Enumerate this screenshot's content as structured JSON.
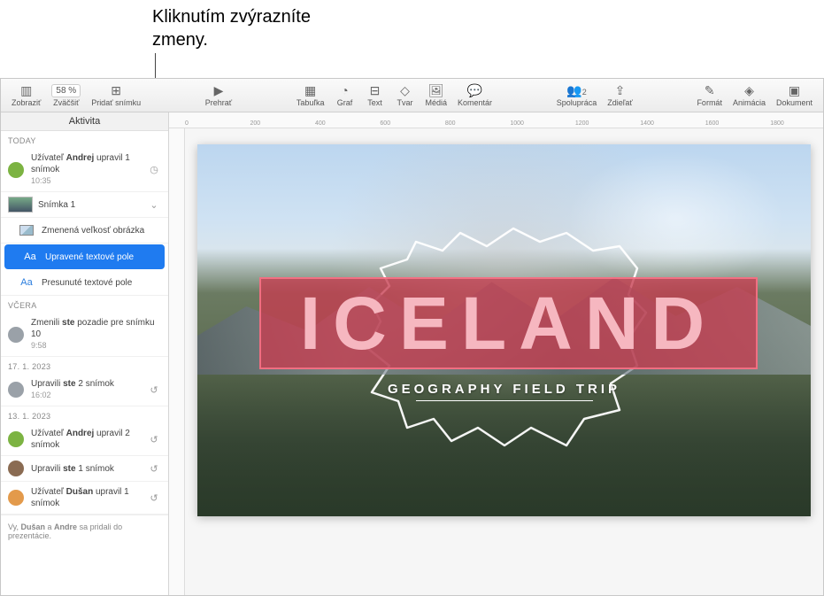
{
  "callout": {
    "line1": "Kliknutím zvýrazníte",
    "line2": "zmeny."
  },
  "toolbar": {
    "view": "Zobraziť",
    "zoom": "Zväčšiť",
    "zoom_value": "58 %",
    "add_slide": "Pridať snímku",
    "play": "Prehrať",
    "table": "Tabuľka",
    "chart": "Graf",
    "text": "Text",
    "shape": "Tvar",
    "media": "Médiá",
    "comment": "Komentár",
    "collab": "Spolupráca",
    "collab_count": "2",
    "share": "Zdieľať",
    "format": "Formát",
    "animate": "Animácia",
    "document": "Dokument"
  },
  "sidebar": {
    "title": "Aktivita",
    "sections": {
      "today": "TODAY",
      "yesterday": "Včera",
      "d1": "17. 1. 2023",
      "d2": "13. 1. 2023"
    },
    "items": {
      "a1_pre": "Užívateľ ",
      "a1_bold": "Andrej",
      "a1_post": " upravil 1 snímok",
      "a1_time": "10:35",
      "slide_label": "Snímka 1",
      "change_resize": "Zmenená veľkosť obrázka",
      "change_edit": "Upravené textové pole",
      "change_move": "Presunuté textové pole",
      "y1_pre": "Zmenili ",
      "y1_bold": "ste",
      "y1_post": " pozadie pre snímku 10",
      "y1_time": "9:58",
      "d1a_pre": "Upravili ",
      "d1a_bold": "ste",
      "d1a_post": " 2 snímok",
      "d1a_time": "16:02",
      "d2a_pre": "Užívateľ ",
      "d2a_bold": "Andrej",
      "d2a_post": " upravil 2 snímok",
      "d2b_pre": "Upravili ",
      "d2b_bold": "ste",
      "d2b_post": " 1 snímok",
      "d2c_pre": "Užívateľ ",
      "d2c_bold": "Dušan",
      "d2c_post": " upravil 1 snímok"
    },
    "footnote_pre": "Vy, ",
    "footnote_b1": "Dušan",
    "footnote_mid": " a ",
    "footnote_b2": "Andre",
    "footnote_post": " sa pridali do prezentácie."
  },
  "ruler": {
    "marks": [
      "0",
      "200",
      "400",
      "600",
      "800",
      "1000",
      "1200",
      "1400",
      "1600",
      "1800"
    ]
  },
  "slide": {
    "title": "ICELAND",
    "subtitle": "GEOGRAPHY FIELD TRIP"
  }
}
